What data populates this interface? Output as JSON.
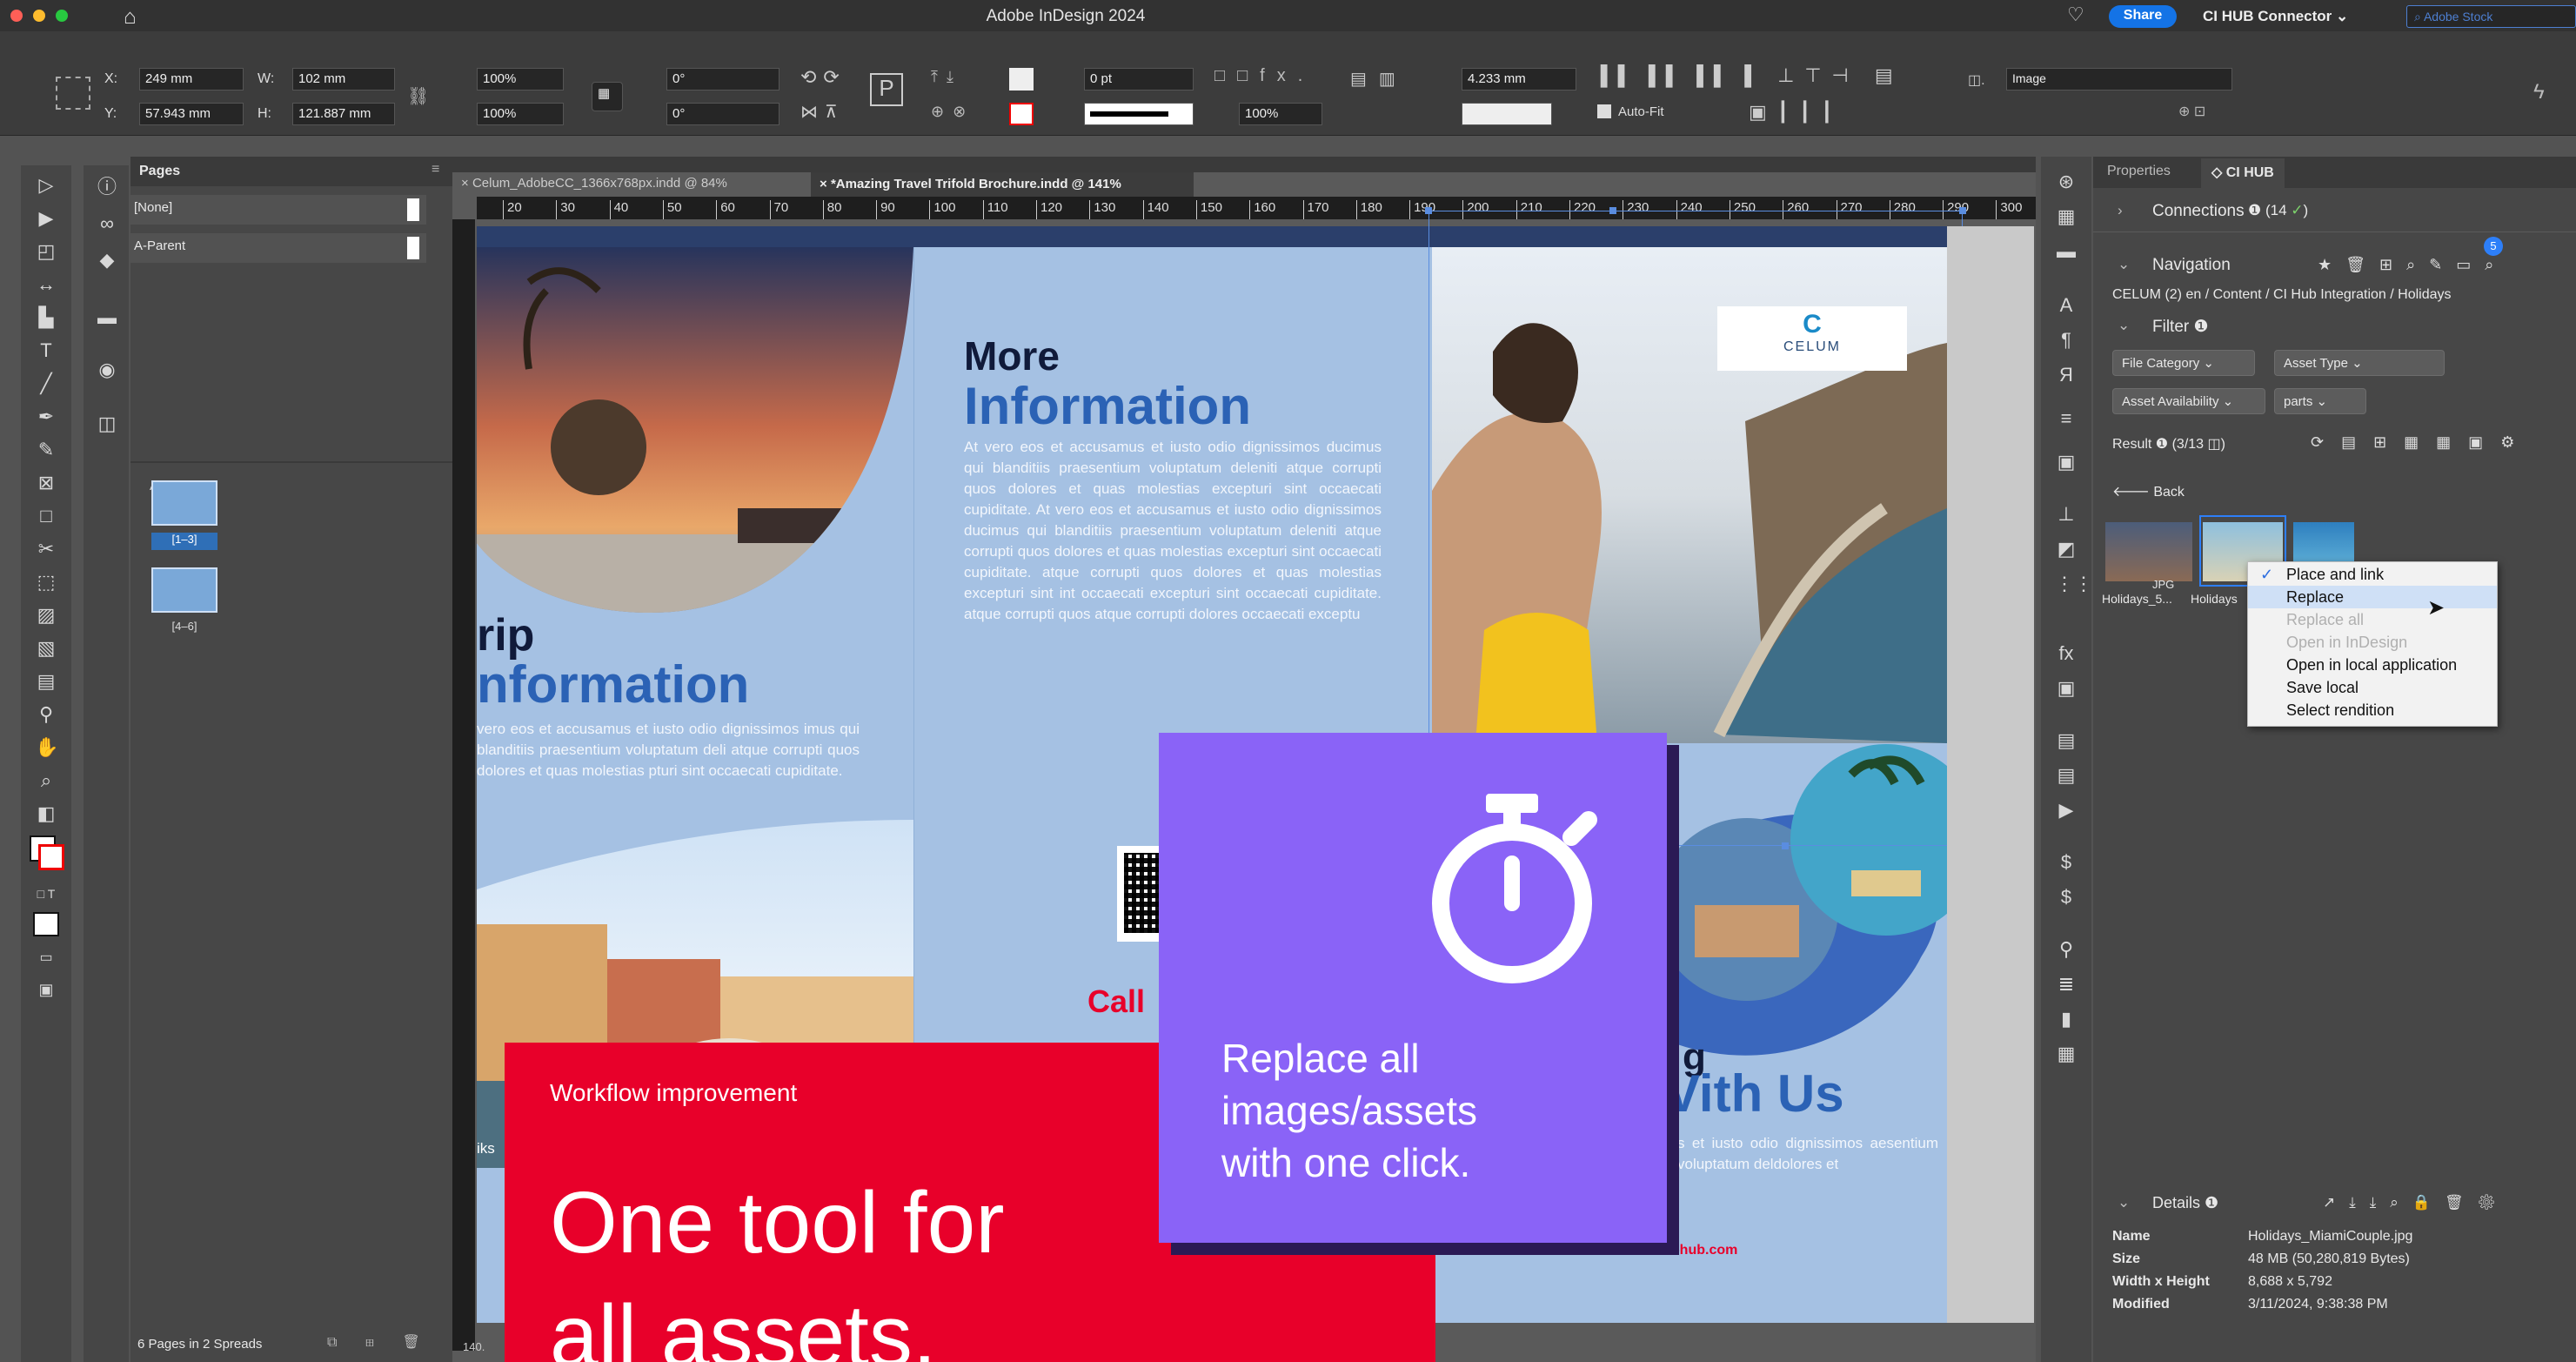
{
  "app": {
    "title": "Adobe InDesign 2024",
    "share": "Share",
    "connector": "CI HUB Connector",
    "stock_search_placeholder": "Adobe Stock"
  },
  "controlbar": {
    "x": "249 mm",
    "y": "57.943 mm",
    "w": "102 mm",
    "h": "121.887 mm",
    "scale_x": "100%",
    "scale_y": "100%",
    "angle": "0°",
    "shear": "0°",
    "stroke_weight": "0 pt",
    "opacity": "100%",
    "spacing": "4.233 mm",
    "autofit": "Auto-Fit",
    "object_style": "Image"
  },
  "tabs": [
    {
      "label": "Celum_AdobeCC_1366x768px.indd @ 84%"
    },
    {
      "label": "*Amazing Travel Trifold Brochure.indd @ 141%"
    }
  ],
  "ruler": [
    "20",
    "30",
    "40",
    "50",
    "60",
    "70",
    "80",
    "90",
    "100",
    "110",
    "120",
    "130",
    "140",
    "150",
    "160",
    "170",
    "180",
    "190",
    "200",
    "210",
    "220",
    "230",
    "240",
    "250",
    "260",
    "270",
    "280",
    "290",
    "300"
  ],
  "pages_panel": {
    "title": "Pages",
    "none": "[None]",
    "parent": "A-Parent",
    "spread1_label": "[1–3]",
    "spread2_label": "[4–6]",
    "footer": "6 Pages in 2 Spreads",
    "bottom_ruler": "140."
  },
  "brochure": {
    "more": "More",
    "information": "Information",
    "body": "At vero eos et accusamus et iusto odio dignissimos ducimus qui blanditiis praesentium voluptatum deleniti atque corrupti quos dolores et quas molestias excepturi sint occaecati cupiditate. At vero eos et accusamus et iusto odio dignissimos ducimus qui blanditiis praesentium voluptatum deleniti atque corrupti quos dolores et quas molestias excepturi sint occaecati cupiditate. atque corrupti quos dolores et quas molestias excepturi sint int occaecati excepturi sint occaecati cupiditate. atque corrupti quos atque corrupti dolores occaecati exceptu",
    "trip": "rip",
    "trip_information": "nformation",
    "trip_body": "vero eos et accusamus et iusto odio dignissimos imus qui blanditiis praesentium voluptatum deli atque corrupti quos dolores et quas molestias pturi sint occaecati cupiditate.",
    "call": "Call",
    "with_us": "Vith Us",
    "g": "g",
    "with_body": "s et iusto odio dignissimos aesentium voluptatum deldolores et",
    "web": "ci-hub.com",
    "logo": "CELUM",
    "side_text": "iks"
  },
  "overlay_red": {
    "eyebrow": "Workflow improvement",
    "line1": "One tool for",
    "line2": "all assets."
  },
  "overlay_purple": {
    "line1": "Replace all",
    "line2": "images/assets",
    "line3": "with one click."
  },
  "right_panel": {
    "tab_properties": "Properties",
    "tab_cihub": "CI HUB",
    "connections": "Connections",
    "connections_count": "(14",
    "navigation": "Navigation",
    "nav_badge": "5",
    "breadcrumb": "CELUM (2)  en  / Content / CI Hub Integration / Holidays",
    "filter": "Filter",
    "filters": [
      "File Category",
      "Asset Type",
      "Asset Availability",
      "parts"
    ],
    "result": "Result",
    "result_count": "(3/13",
    "back": "Back",
    "thumb1_caption": "Holidays_5...",
    "thumb2_caption": "Holidays",
    "thumb_type": "JPG",
    "menu": [
      "Place and link",
      "Replace",
      "Replace all",
      "Open in InDesign",
      "Open in local application",
      "Save local",
      "Select rendition"
    ],
    "details": "Details",
    "detail_rows": [
      {
        "k": "Name",
        "v": "Holidays_MiamiCouple.jpg"
      },
      {
        "k": "Size",
        "v": "48 MB (50,280,819 Bytes)"
      },
      {
        "k": "Width x Height",
        "v": "8,688 x 5,792"
      },
      {
        "k": "Modified",
        "v": "3/11/2024, 9:38:38 PM"
      }
    ]
  },
  "colors": {
    "red": "#e8002a",
    "purple": "#8a63f7",
    "brochure_blue": "#a5c1e3",
    "navy": "#101a3a"
  }
}
